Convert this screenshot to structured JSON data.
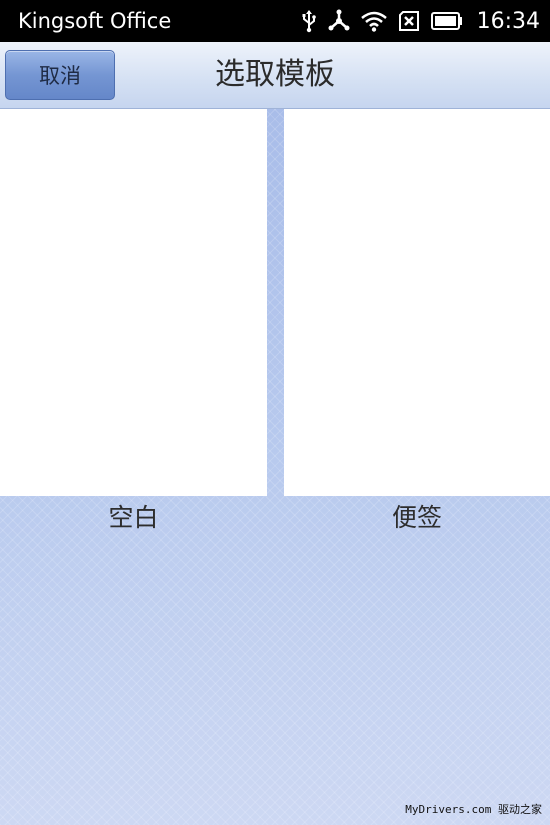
{
  "status_bar": {
    "app_name": "Kingsoft Office",
    "time": "16:34",
    "icons": [
      "usb-icon",
      "share-icon",
      "wifi-icon",
      "no-sim-icon",
      "battery-icon"
    ]
  },
  "header": {
    "cancel_label": "取消",
    "title": "选取模板"
  },
  "templates": [
    {
      "label": "空白"
    },
    {
      "label": "便签"
    }
  ],
  "watermark": "MyDrivers.com 驱动之家",
  "colors": {
    "status_bar": "#000000",
    "header_top": "#eef3fb",
    "header_bottom": "#c6d5ef",
    "button": "#7596d3",
    "content_bg": "#b3c6ec"
  }
}
